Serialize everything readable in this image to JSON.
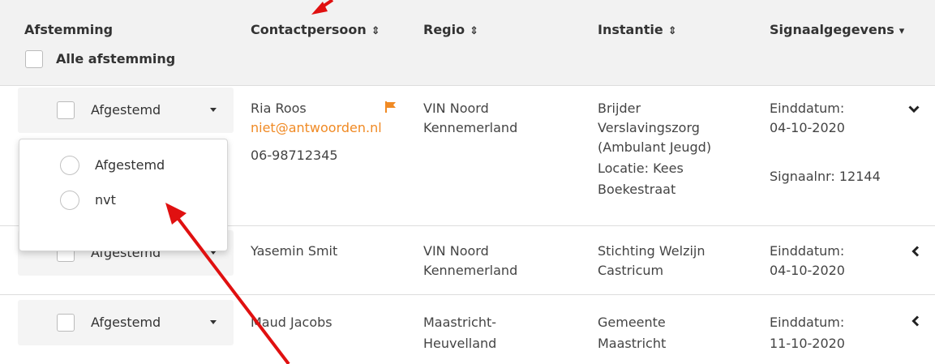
{
  "header": {
    "afstemming": "Afstemming",
    "alle_afstemming": "Alle afstemming",
    "contactpersoon": "Contactpersoon",
    "regio": "Regio",
    "instantie": "Instantie",
    "signaalgegevens": "Signaalgegevens",
    "sort_icon": "⇕",
    "dropdown_icon": "▾"
  },
  "rows": [
    {
      "status": "Afgestemd",
      "name": "Ria Roos",
      "email": "niet@antwoorden.nl",
      "phone": "06-98712345",
      "regio": [
        "VIN Noord",
        "Kennemerland"
      ],
      "instantie": [
        "Brijder",
        "Verslavingszorg",
        "(Ambulant Jeugd)",
        "Locatie: Kees",
        "Boekestraat"
      ],
      "einddatum_label": "Einddatum:",
      "einddatum": "04-10-2020",
      "signaalnr": "Signaalnr: 12144",
      "expanded": true
    },
    {
      "status": "Afgestemd",
      "name": "Yasemin Smit",
      "regio": [
        "VIN Noord",
        "Kennemerland"
      ],
      "instantie": [
        "Stichting Welzijn",
        "Castricum"
      ],
      "einddatum_label": "Einddatum:",
      "einddatum": "04-10-2020",
      "expanded": false
    },
    {
      "status": "Afgestemd",
      "name": "Maud Jacobs",
      "regio": [
        "Maastricht-",
        "Heuvelland"
      ],
      "instantie": [
        "Gemeente",
        "Maastricht"
      ],
      "einddatum_label": "Einddatum:",
      "einddatum": "11-10-2020",
      "expanded": false
    }
  ],
  "dropdown": {
    "options": [
      "Afgestemd",
      "nvt"
    ]
  },
  "colors": {
    "header_bg": "#f2f2f2",
    "accent_orange": "#f08a24",
    "annotation_red": "#e01010"
  },
  "icons": {
    "flag": "flag-icon",
    "expanded": "chevron-down-icon",
    "collapsed": "chevron-left-icon"
  }
}
